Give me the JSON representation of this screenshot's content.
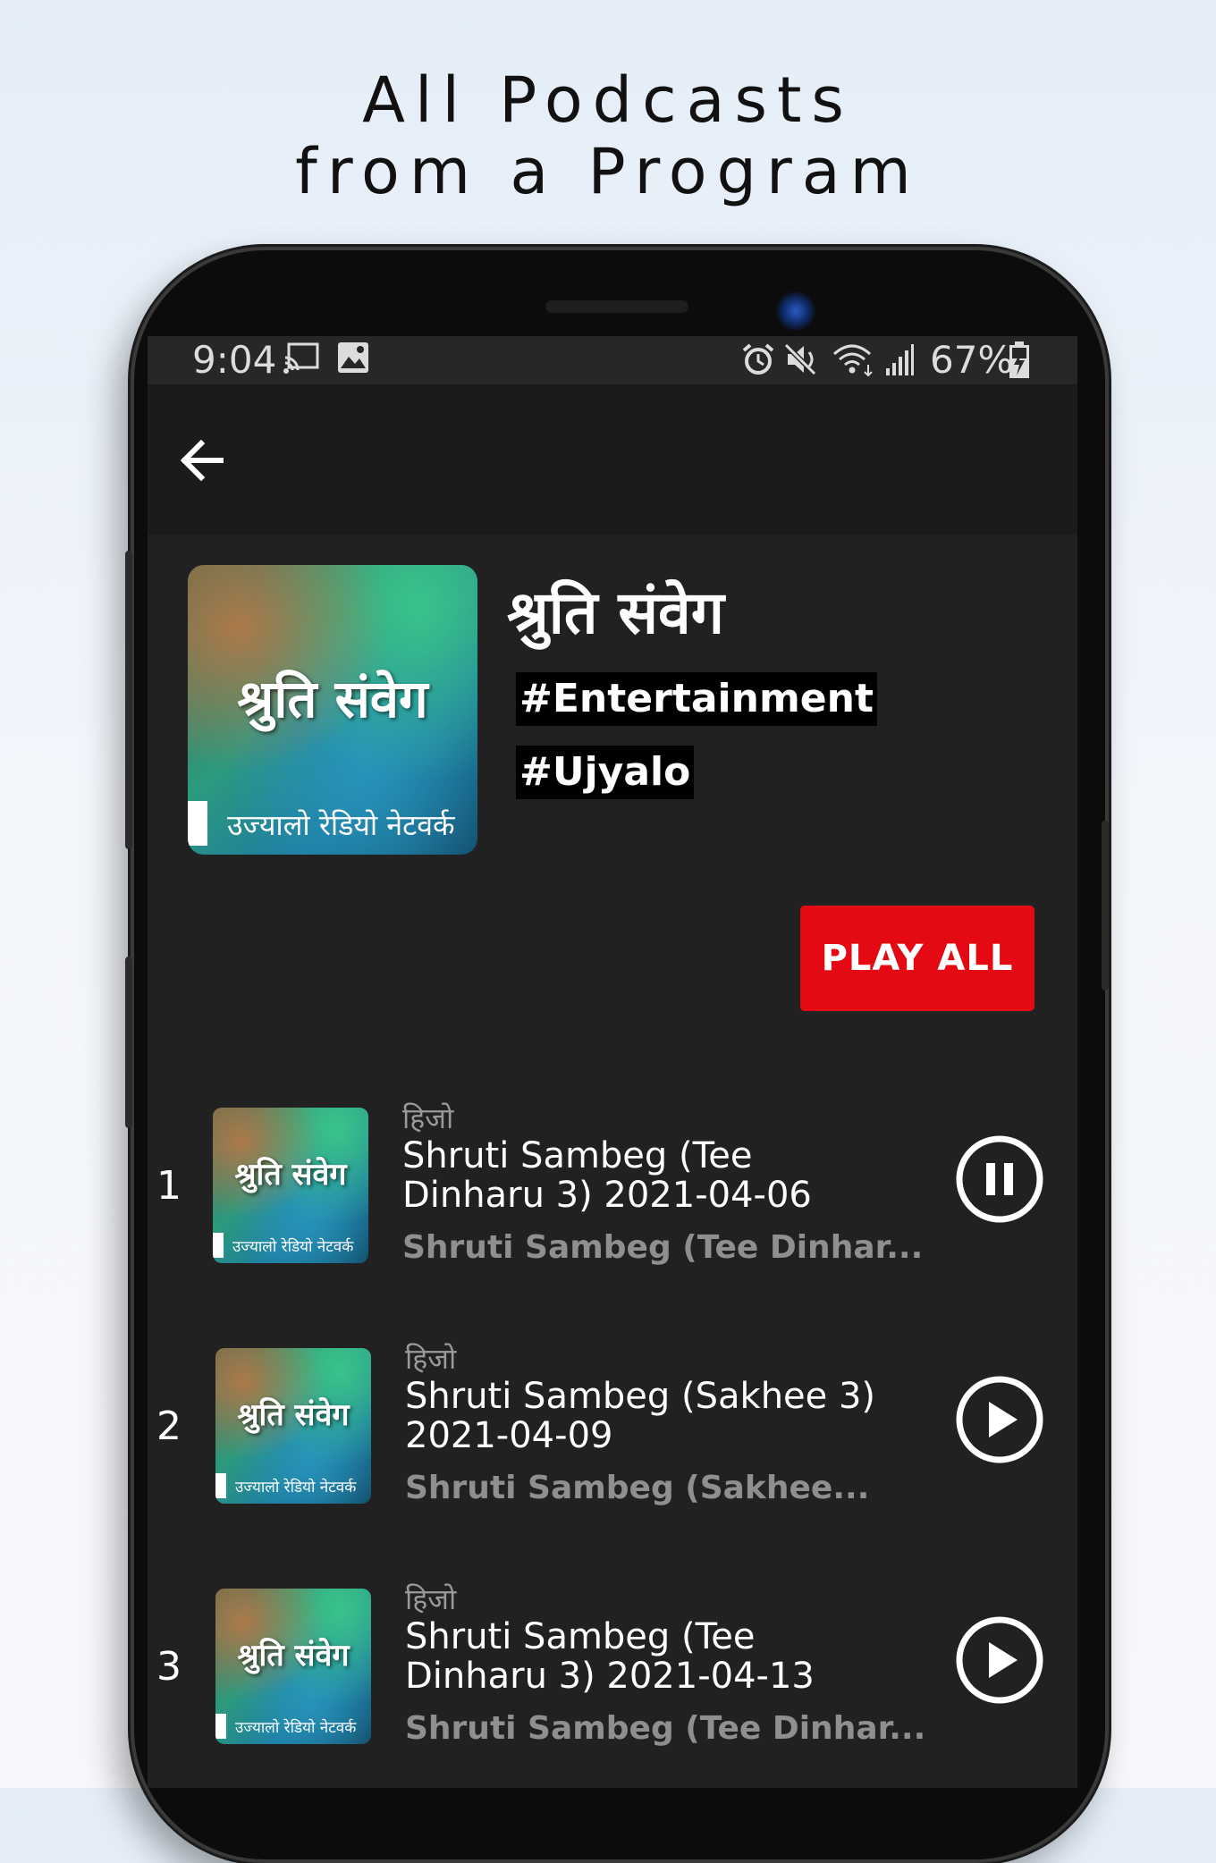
{
  "header": {
    "line1": "All Podcasts",
    "line2": "from a Program"
  },
  "status_bar": {
    "time": "9:04",
    "battery_percent": "67%",
    "left_icons": [
      "cast-icon",
      "image-icon"
    ],
    "right_icons": [
      "alarm-icon",
      "mute-icon",
      "wifi-icon",
      "signal-icon",
      "battery-charging-icon"
    ]
  },
  "app_bar": {
    "back_icon": "arrow-left-icon"
  },
  "program": {
    "title": "श्रुति संवेग",
    "tags": [
      "#Entertainment",
      "#Ujyalo"
    ],
    "cover": {
      "title": "श्रुति संवेग",
      "footer": "उज्यालो रेडियो नेटवर्क"
    },
    "play_all_label": "PLAY ALL"
  },
  "episodes": [
    {
      "number": "1",
      "date": "हिजो",
      "title": "Shruti Sambeg (Tee Dinharu 3) 2021-04-06",
      "subtitle": "Shruti Sambeg (Tee Dinhar...",
      "state_icon": "pause-icon"
    },
    {
      "number": "2",
      "date": "हिजो",
      "title": "Shruti Sambeg (Sakhee 3) 2021-04-09",
      "subtitle": "Shruti Sambeg (Sakhee...",
      "state_icon": "play-icon"
    },
    {
      "number": "3",
      "date": "हिजो",
      "title": "Shruti Sambeg (Tee Dinharu 3) 2021-04-13",
      "subtitle": "Shruti Sambeg (Tee Dinhar...",
      "state_icon": "play-icon"
    }
  ],
  "colors": {
    "accent": "#e50914",
    "background": "#212121",
    "app_bar": "#1b1b1b"
  }
}
